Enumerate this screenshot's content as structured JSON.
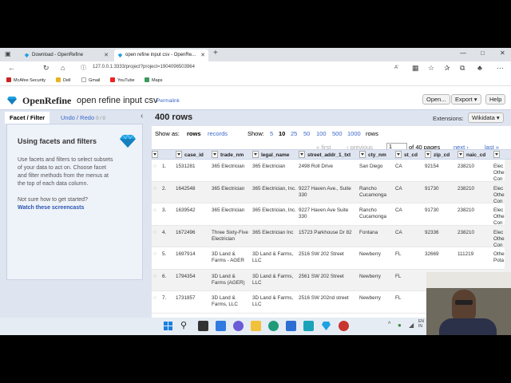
{
  "browser": {
    "tabs": [
      {
        "label": "Download - OpenRefine",
        "active": false
      },
      {
        "label": "open refine input csv - OpenRe...",
        "active": true
      }
    ],
    "new_tab": "+",
    "url": "127.0.0.1:3333/project?project=1904096503964",
    "bookmarks": [
      "McAfee Security",
      "Dell",
      "Gmail",
      "YouTube",
      "Maps"
    ]
  },
  "app": {
    "logo": "OpenRefine",
    "project_name": "open refine input csv",
    "permalink": "Permalink",
    "buttons": {
      "open": "Open...",
      "export": "Export ▾",
      "help": "Help"
    }
  },
  "left_panel": {
    "tab_facet": "Facet / Filter",
    "tab_undo": "Undo / Redo",
    "undo_count": "0 / 0",
    "collapse": "‹",
    "help_title": "Using facets and filters",
    "help_text": [
      "Use facets and filters to select subsets",
      "of your data to act on. Choose facet",
      "and filter methods from the menus at",
      "the top of each data column."
    ],
    "help_prompt": "Not sure how to get started?",
    "help_link": "Watch these screencasts"
  },
  "grid": {
    "row_count": "400 rows",
    "extensions_label": "Extensions:",
    "wikidata": "Wikidata ▾",
    "show_as": "Show as:",
    "rows_mode": "rows",
    "records_mode": "records",
    "show_label": "Show:",
    "page_sizes": [
      "5",
      "10",
      "25",
      "50",
      "100",
      "500",
      "1000"
    ],
    "page_size_selected": "10",
    "rows_suffix": "rows",
    "first": "« first",
    "previous": "‹ previous",
    "page": "1",
    "of_pages": "of 40 pages",
    "next": "next ›",
    "last": "last »",
    "columns": [
      "All",
      "case_id",
      "trade_nm",
      "legal_name",
      "street_addr_1_txt",
      "cty_nm",
      "st_cd",
      "zip_cd",
      "naic_cd",
      ""
    ],
    "rows": [
      {
        "n": "1.",
        "case_id": "1531281",
        "trade_nm": "365 Electrician",
        "legal_name": "365 Electrician",
        "street": "2498 Roll Drive",
        "city": "San Diego",
        "st": "CA",
        "zip": "92154",
        "naic": "238210",
        "extra": "Elec Othe Con"
      },
      {
        "n": "2.",
        "case_id": "1642548",
        "trade_nm": "365 Electrician",
        "legal_name": "365 Electrician, Inc.",
        "street": "9227 Haven Ave., Suite 330",
        "city": "Rancho Cucamonga",
        "st": "CA",
        "zip": "91730",
        "naic": "238210",
        "extra": "Elec Othe Con"
      },
      {
        "n": "3.",
        "case_id": "1639542",
        "trade_nm": "365 Electrician",
        "legal_name": "365 Electrician, Inc.",
        "street": "9227 Haven Ave Suite 330",
        "city": "Rancho Cucamonga",
        "st": "CA",
        "zip": "91730",
        "naic": "238210",
        "extra": "Elec Othe Con"
      },
      {
        "n": "4.",
        "case_id": "1672496",
        "trade_nm": "Three Sixty-Five Electrician",
        "legal_name": "365 Electrician Inc",
        "street": "15723 Parkhouse Dr 82",
        "city": "Fontana",
        "st": "CA",
        "zip": "92336",
        "naic": "238210",
        "extra": "Elec Othe Con"
      },
      {
        "n": "5.",
        "case_id": "1697914",
        "trade_nm": "3D Land & Farms - AGER",
        "legal_name": "3D Land & Farms, LLC",
        "street": "2516 SW 202 Street",
        "city": "Newberry",
        "st": "FL",
        "zip": "32669",
        "naic": "111219",
        "extra": "Othe Pota"
      },
      {
        "n": "6.",
        "case_id": "1794354",
        "trade_nm": "3D Land & Farms (AGER)",
        "legal_name": "3D Land & Farms, LLC",
        "street": "2561 SW 202 Street",
        "city": "Newberry",
        "st": "FL",
        "zip": "",
        "naic": "",
        "extra": ""
      },
      {
        "n": "7.",
        "case_id": "1731857",
        "trade_nm": "3D Land & Farms, LLC",
        "legal_name": "3D Land & Farms, LLC",
        "street": "2516 SW 202nd street",
        "city": "Newberry",
        "st": "FL",
        "zip": "",
        "naic": "",
        "extra": ""
      }
    ]
  },
  "taskbar": {
    "clock": "EN IN",
    "tray": "^"
  },
  "colors": {
    "accent": "#3a67c8",
    "header_bg": "#dfe5f0",
    "logo_blue": "#1ea1e3"
  }
}
